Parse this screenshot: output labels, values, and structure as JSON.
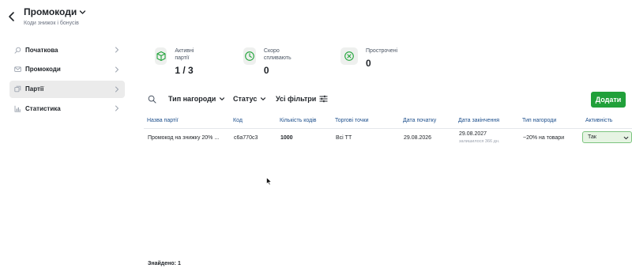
{
  "header": {
    "title": "Промокоди",
    "subtitle": "Коди знижок і бонусів"
  },
  "sidebar": {
    "items": [
      {
        "label": "Початкова",
        "icon": "search-icon"
      },
      {
        "label": "Промокоди",
        "icon": "mail-icon"
      },
      {
        "label": "Партії",
        "icon": "stack-icon",
        "active": true
      },
      {
        "label": "Статистика",
        "icon": "bar-chart-icon"
      }
    ]
  },
  "stats": [
    {
      "label": "Активні партії",
      "value": "1 / 3",
      "icon": "box-icon"
    },
    {
      "label": "Скоро спливають",
      "value": "0",
      "icon": "clock-icon"
    },
    {
      "label": "Прострочені",
      "value": "0",
      "icon": "x-circle-icon"
    }
  ],
  "toolbar": {
    "reward_type": "Тип нагороди",
    "status": "Статус",
    "all_filters": "Усі фільтри",
    "add": "Додати"
  },
  "table": {
    "columns": [
      "Назва партії",
      "Код",
      "Кількість кодів",
      "Торгові точки",
      "Дата початку",
      "Дата закінчення",
      "Тип нагороди",
      "Активність"
    ],
    "rows": [
      {
        "name": "Промокод на знижку 20% ...",
        "code": "c6a770c3",
        "count": "1000",
        "stores": "Всі ТТ",
        "start": "29.08.2026",
        "end": "29.08.2027",
        "end_note": "залишилося 366 дн.",
        "reward": "~20% на товари",
        "active": "Так"
      }
    ]
  },
  "footer": {
    "found_label": "Знайдено:",
    "found_count": "1"
  },
  "colors": {
    "accent": "#21a03a",
    "header_link": "#1d4f8c",
    "active_bg": "#e6f4e3"
  }
}
